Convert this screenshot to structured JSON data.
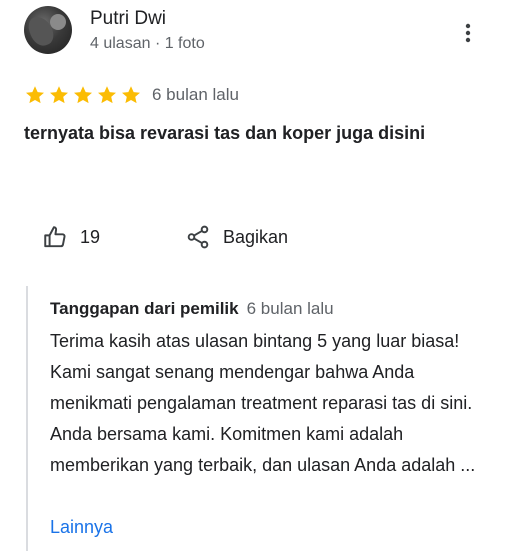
{
  "author": {
    "name": "Putri Dwi",
    "meta": "4 ulasan · 1 foto"
  },
  "review": {
    "rating": 5,
    "max_rating": 5,
    "date": "6 bulan lalu",
    "text": "ternyata bisa revarasi tas dan koper juga disini"
  },
  "actions": {
    "like_count": "19",
    "share_label": "Bagikan"
  },
  "owner_response": {
    "title": "Tanggapan dari pemilik",
    "date": "6 bulan lalu",
    "text": "Terima kasih atas ulasan bintang 5 yang luar biasa! Kami sangat senang mendengar bahwa Anda menikmati pengalaman treatment reparasi tas di sini. Anda bersama kami. Komitmen kami adalah memberikan yang terbaik, dan ulasan Anda adalah ...",
    "more_label": "Lainnya"
  },
  "colors": {
    "star": "#fbbc04",
    "link": "#1a73e8",
    "muted": "#5f6368",
    "text": "#202124",
    "divider": "#dadce0"
  },
  "icons": {
    "more": "more-vert-icon",
    "like": "thumb-up-icon",
    "share": "share-icon",
    "star": "star-icon"
  }
}
